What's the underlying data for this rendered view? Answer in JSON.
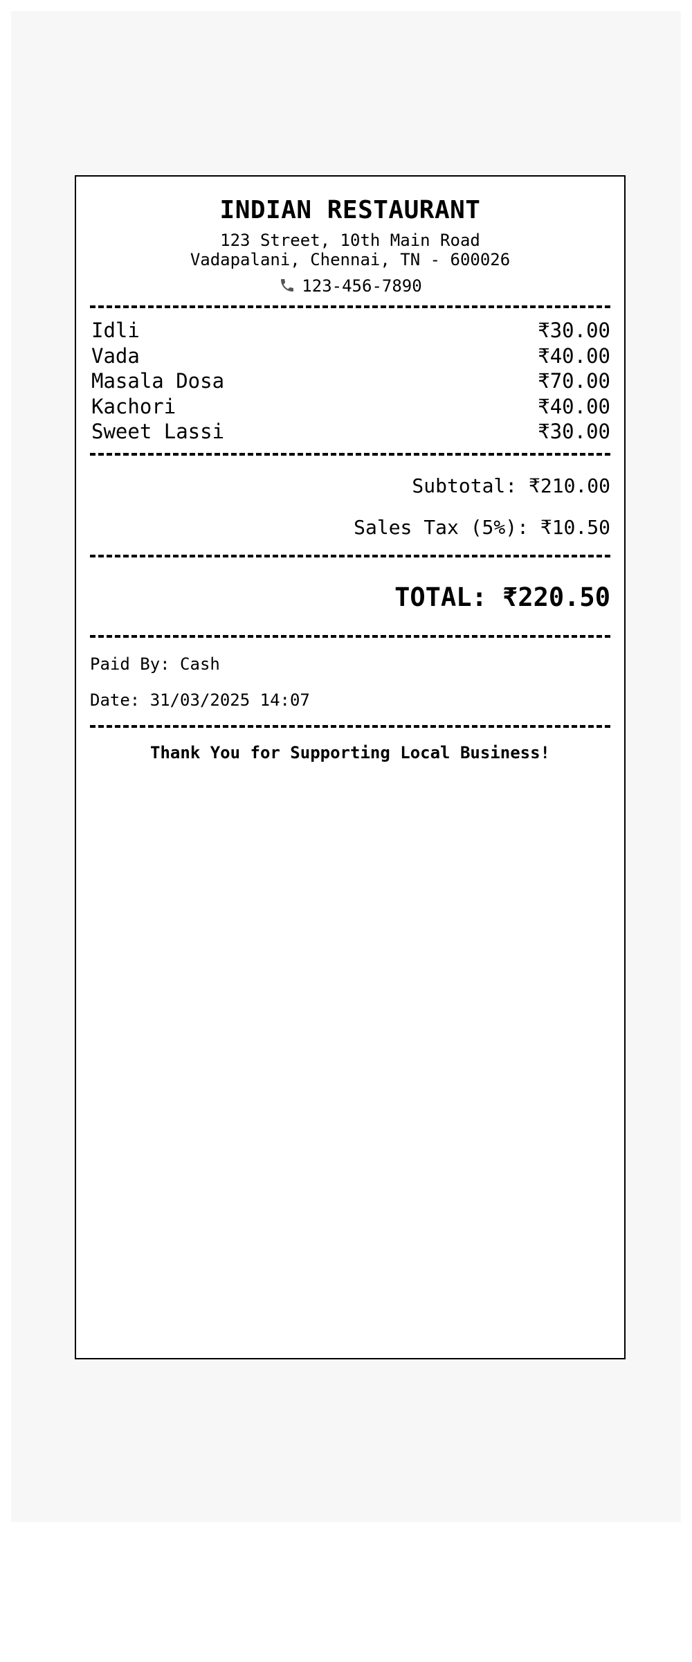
{
  "restaurant": {
    "name": "INDIAN RESTAURANT",
    "address_line1": "123 Street, 10th Main Road",
    "address_line2": "Vadapalani, Chennai, TN - 600026",
    "phone": "123-456-7890",
    "phone_icon": "phone-icon"
  },
  "items": [
    {
      "name": "Idli",
      "price": "₹30.00"
    },
    {
      "name": "Vada",
      "price": "₹40.00"
    },
    {
      "name": "Masala Dosa",
      "price": "₹70.00"
    },
    {
      "name": "Kachori",
      "price": "₹40.00"
    },
    {
      "name": "Sweet Lassi",
      "price": "₹30.00"
    }
  ],
  "summary": {
    "subtotal": "Subtotal: ₹210.00",
    "tax": "Sales Tax (5%): ₹10.50",
    "total": "TOTAL: ₹220.50"
  },
  "payment": {
    "paid_by": "Paid By: Cash",
    "date": "Date: 31/03/2025 14:07"
  },
  "footer": {
    "message": "Thank You for Supporting Local Business!"
  },
  "colors": {
    "backdrop": "#f7f7f7",
    "paper": "#ffffff",
    "ink": "#000000"
  }
}
